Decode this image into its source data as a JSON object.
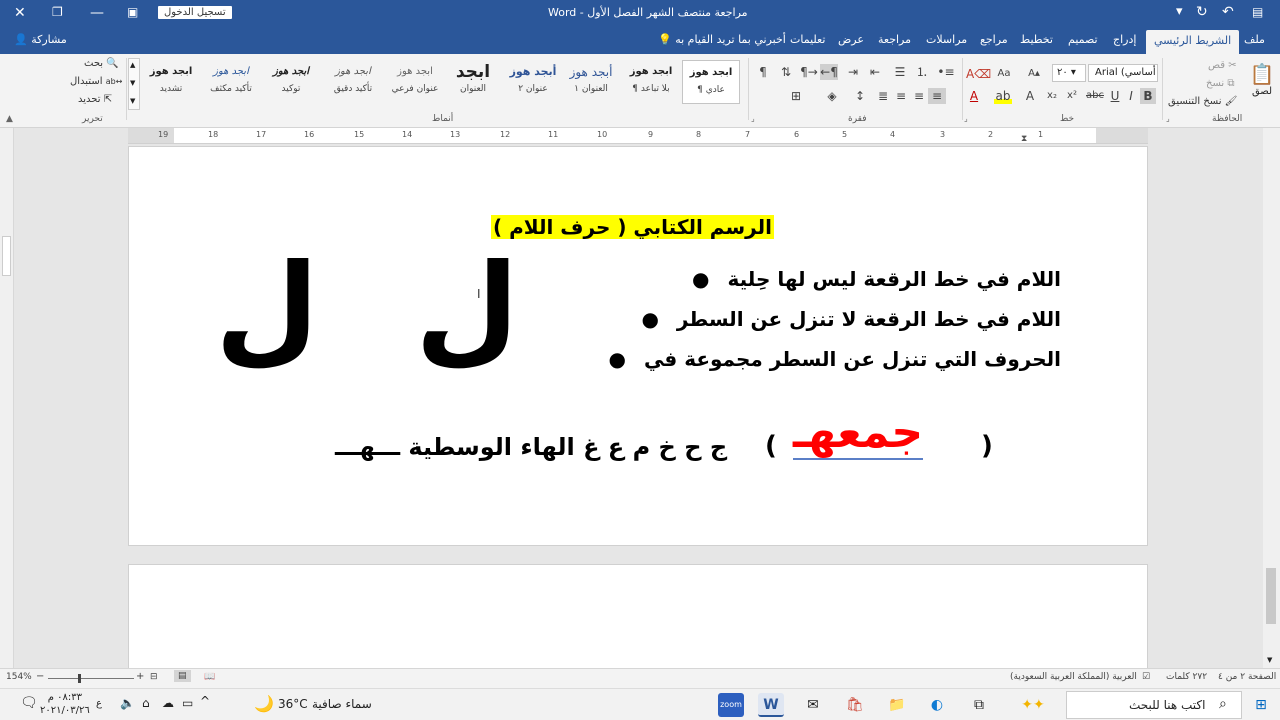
{
  "window": {
    "title": "مراجعة منتصف الشهر الفصل الأول  -  Word",
    "signin_label": "تسجيل الدخول"
  },
  "tabs": {
    "file": "ملف",
    "home": "الشريط الرئيسي",
    "insert": "إدراج",
    "design": "تصميم",
    "layout": "تخطيط",
    "references": "مراجع",
    "mailings": "مراسلات",
    "review": "مراجعة",
    "view": "عرض",
    "help": "تعليمات",
    "tellme": "أخبرني بما تريد القيام به",
    "share": "مشاركة"
  },
  "ribbon": {
    "clipboard": {
      "label": "الحافظة",
      "paste": "لصق",
      "cut": "قص",
      "copy": "نسخ",
      "format_painter": "نسخ التنسيق"
    },
    "font": {
      "label": "خط",
      "name": "Arial (أساسي",
      "size": "٢٠"
    },
    "paragraph": {
      "label": "فقرة"
    },
    "styles": {
      "label": "أنماط",
      "items": [
        {
          "preview": "ابجد هوز",
          "name": "¶ عادي"
        },
        {
          "preview": "ابجد هوز",
          "name": "¶ بلا تباعد"
        },
        {
          "preview": "أبجد هوز",
          "name": "العنوان ١"
        },
        {
          "preview": "أبجد هوز",
          "name": "عنوان ٢"
        },
        {
          "preview": "ابجد",
          "name": "العنوان"
        },
        {
          "preview": "ابجد هوز",
          "name": "عنوان فرعي"
        },
        {
          "preview": "ابجد هوز",
          "name": "تأكيد دقيق"
        },
        {
          "preview": "ابجد هوز",
          "name": "توكيد"
        },
        {
          "preview": "ابجد هوز",
          "name": "تأكيد مكثف"
        },
        {
          "preview": "ابجد هوز",
          "name": "تشديد"
        }
      ]
    },
    "editing": {
      "label": "تحرير",
      "find": "بحث",
      "replace": "استبدال",
      "select": "تحديد"
    }
  },
  "ruler": {
    "ticks": [
      "1",
      "2",
      "3",
      "4",
      "5",
      "6",
      "7",
      "8",
      "9",
      "10",
      "11",
      "12",
      "13",
      "14",
      "15",
      "16",
      "17",
      "18",
      "19"
    ]
  },
  "document": {
    "heading": "الرسم الكتابي ( حرف اللام )",
    "bullets": [
      "اللام في خط الرقعة ليس لها حِلية",
      "اللام في خط الرقعة لا تنزل عن السطر",
      "الحروف التي تنزل عن السطر مجموعة في"
    ],
    "big_letter_1": "ل",
    "big_letter_2": "ل",
    "last_line_paren_open": "(",
    "last_line_red": "جمعهـ",
    "last_line_paren_close": ")",
    "last_line_rest": "ج ح خ م ع غ الهاء الوسطية ـــهـــ"
  },
  "status": {
    "page": "الصفحة ٢ من ٤",
    "words": "٢٧٢ كلمات",
    "language": "العربية (المملكة العربية السعودية)",
    "zoom": "154%"
  },
  "taskbar": {
    "search_placeholder": "اكتب هنا للبحث",
    "weather_temp": "36°C",
    "weather_text": "سماء صافية",
    "time": "٠٨:٣٣ م",
    "date": "٢٠٢١/٠٣/٢٦",
    "lang": "ع"
  },
  "colors": {
    "word_blue": "#2b579a",
    "highlight_yellow": "#ffff00",
    "red_text": "#ff0000"
  }
}
